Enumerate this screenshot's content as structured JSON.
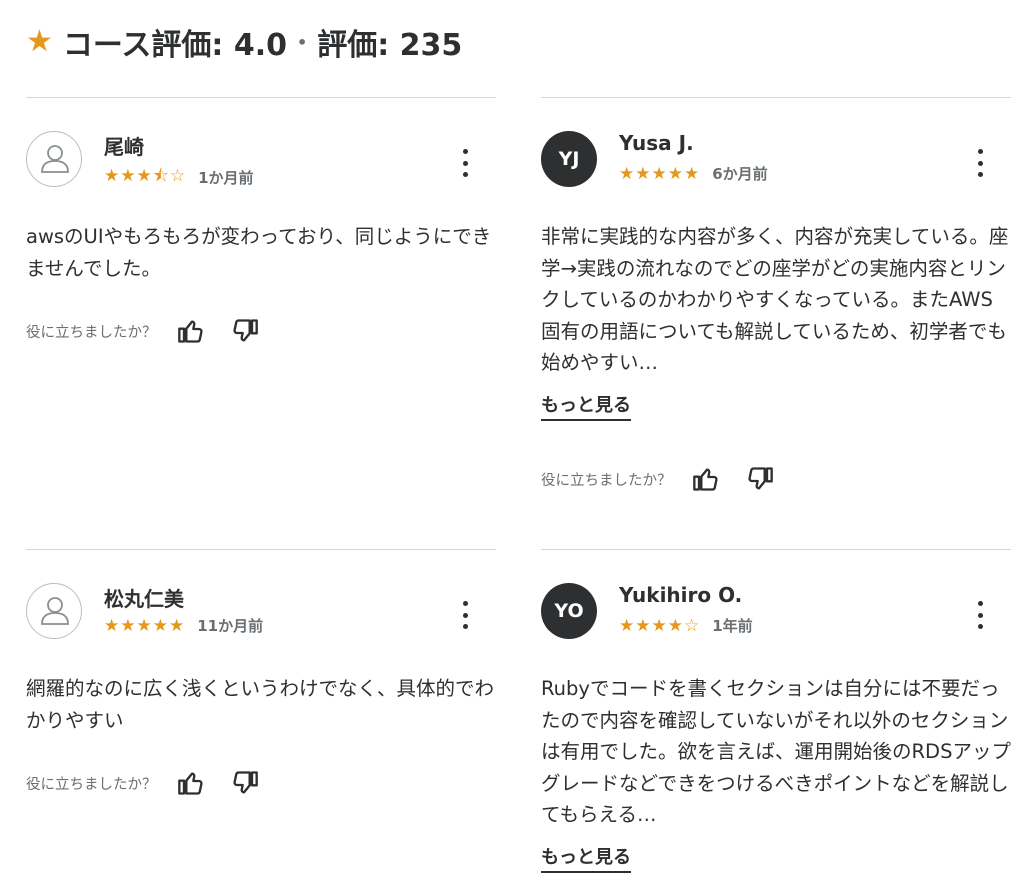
{
  "header": {
    "rating_label": "コース評価: 4.0",
    "separator": "•",
    "count_label": "評価: 235"
  },
  "helpful_question": "役に立ちましたか？",
  "see_more": "もっと見る",
  "reviews": [
    {
      "name": "尾崎",
      "initials": "",
      "stars": "★★★⯪☆",
      "rating": 3.5,
      "time": "1か月前",
      "text": "awsのUIやもろもろが変わっており、同じようにできませんでした。"
    },
    {
      "name": "Yusa J.",
      "initials": "YJ",
      "stars": "★★★★★",
      "rating": 5,
      "time": "6か月前",
      "text": "非常に実践的な内容が多く、内容が充実している。座学→実践の流れなのでどの座学がどの実施内容とリンクしているのかわかりやすくなっている。またAWS固有の用語についても解説しているため、初学者でも始めやすい…"
    },
    {
      "name": "松丸仁美",
      "initials": "",
      "stars": "★★★★★",
      "rating": 5,
      "time": "11か月前",
      "text": "網羅的なのに広く浅くというわけでなく、具体的でわかりやすい"
    },
    {
      "name": "Yukihiro O.",
      "initials": "YO",
      "stars": "★★★★☆",
      "rating": 4,
      "time": "1年前",
      "text": "Rubyでコードを書くセクションは自分には不要だったので内容を確認していないがそれ以外のセクションは有用でした。欲を言えば、運用開始後のRDSアップグレードなどできをつけるべきポイントなどを解説してもらえる…"
    }
  ],
  "colors": {
    "star": "#e59819",
    "text": "#2d2f31",
    "muted": "#6a6f73",
    "divider": "#d1d7dc"
  }
}
